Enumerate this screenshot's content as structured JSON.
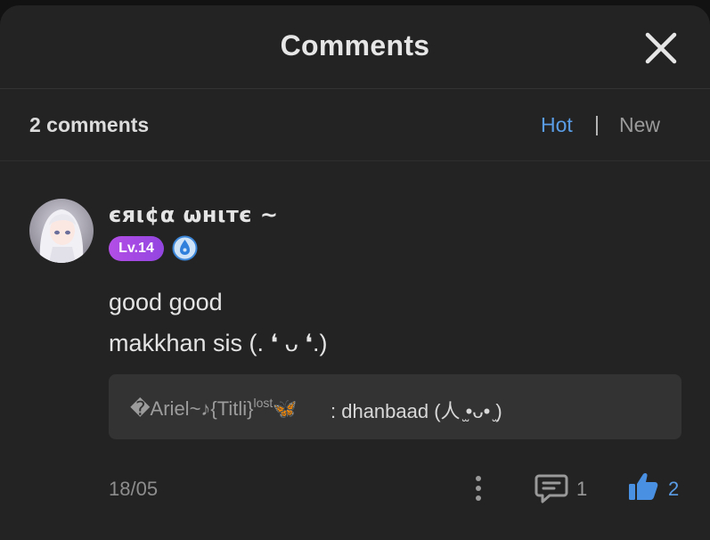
{
  "header": {
    "title": "Comments",
    "close_icon": "close-icon"
  },
  "subbar": {
    "count_label": "2 comments",
    "sort_options": [
      "Hot",
      "New"
    ],
    "separator": "|",
    "active_sort": "Hot",
    "accent_color": "#5a9de6"
  },
  "comment": {
    "author": "єяι¢α ωнιтє ~",
    "level": "Lv.14",
    "badge_icon": "pen-badge-icon",
    "lines": [
      "good good",
      "makkhan sis (. ❛ ᴗ ❛.)"
    ],
    "reply": {
      "author": "�Ariel~♪{Titli}",
      "author_sup": "lost",
      "author_suffix": "🦋",
      "text": ": dhanbaad (人 ̫•ᴗ• ̫)"
    },
    "date": "18/05",
    "comment_count": "1",
    "like_count": "2"
  }
}
